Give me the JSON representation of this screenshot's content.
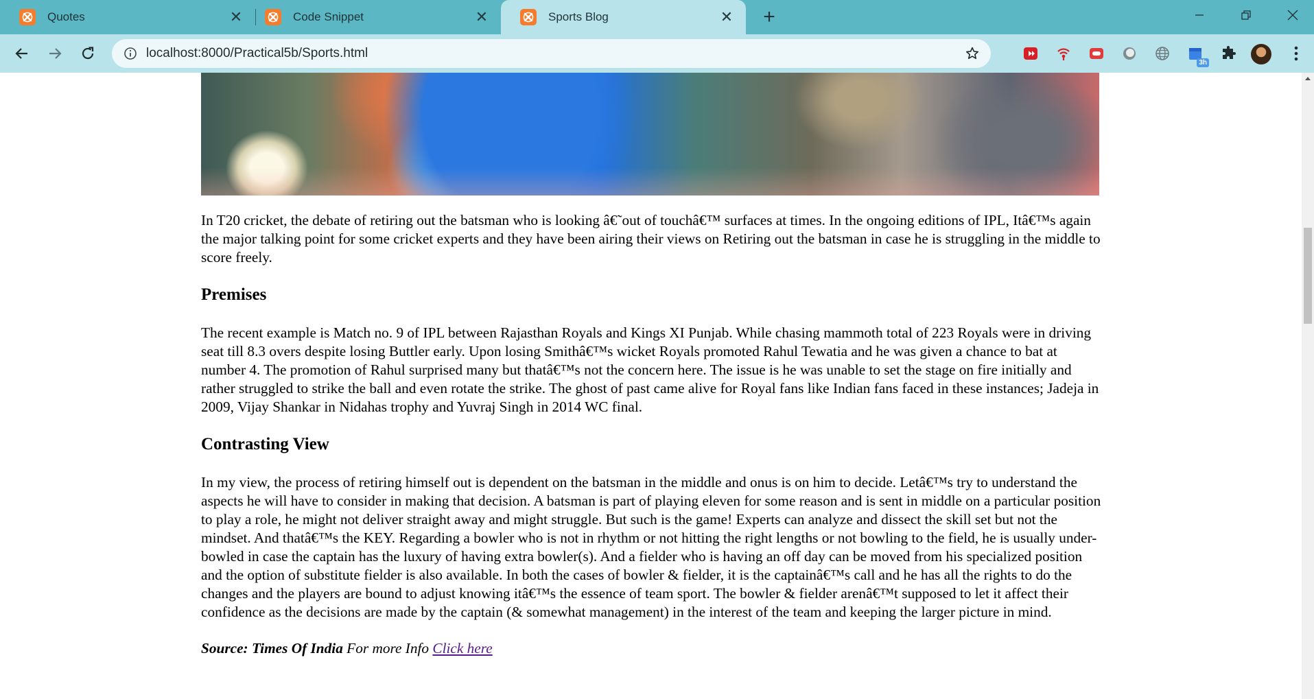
{
  "browser": {
    "tabs": [
      {
        "title": "Quotes",
        "active": false
      },
      {
        "title": "Code Snippet",
        "active": false
      },
      {
        "title": "Sports Blog",
        "active": true
      }
    ],
    "url": "localhost:8000/Practical5b/Sports.html",
    "extension_badge": "3h",
    "accent": "#5ab7c3",
    "toolbar_color": "#b9e3ea"
  },
  "article": {
    "intro": "In T20 cricket, the debate of retiring out the batsman who is looking â€˜out of touchâ€™ surfaces at times. In the ongoing editions of IPL, Itâ€™s again the major talking point for some cricket experts and they have been airing their views on Retiring out the batsman in case he is struggling in the middle to score freely.",
    "sections": [
      {
        "heading": "Premises",
        "body": "The recent example is Match no. 9 of IPL between Rajasthan Royals and Kings XI Punjab. While chasing mammoth total of 223 Royals were in driving seat till 8.3 overs despite losing Buttler early. Upon losing Smithâ€™s wicket Royals promoted Rahul Tewatia and he was given a chance to bat at number 4. The promotion of Rahul surprised many but thatâ€™s not the concern here. The issue is he was unable to set the stage on fire initially and rather struggled to strike the ball and even rotate the strike. The ghost of past came alive for Royal fans like Indian fans faced in these instances; Jadeja in 2009, Vijay Shankar in Nidahas trophy and Yuvraj Singh in 2014 WC final."
      },
      {
        "heading": "Contrasting View",
        "body": "In my view, the process of retiring himself out is dependent on the batsman in the middle and onus is on him to decide. Letâ€™s try to understand the aspects he will have to consider in making that decision. A batsman is part of playing eleven for some reason and is sent in middle on a particular position to play a role, he might not deliver straight away and might struggle. But such is the game! Experts can analyze and dissect the skill set but not the mindset. And thatâ€™s the KEY. Regarding a bowler who is not in rhythm or not hitting the right lengths or not bowling to the field, he is usually under-bowled in case the captain has the luxury of having extra bowler(s). And a fielder who is having an off day can be moved from his specialized position and the option of substitute fielder is also available. In both the cases of bowler & fielder, it is the captainâ€™s call and he has all the rights to do the changes and the players are bound to adjust knowing itâ€™s the essence of team sport. The bowler & fielder arenâ€™t supposed to let it affect their confidence as the decisions are made by the captain (& somewhat management) in the interest of the team and keeping the larger picture in mind."
      }
    ],
    "source_label": "Source: Times Of India",
    "more_info": " For more Info ",
    "link_text": "Click here"
  }
}
